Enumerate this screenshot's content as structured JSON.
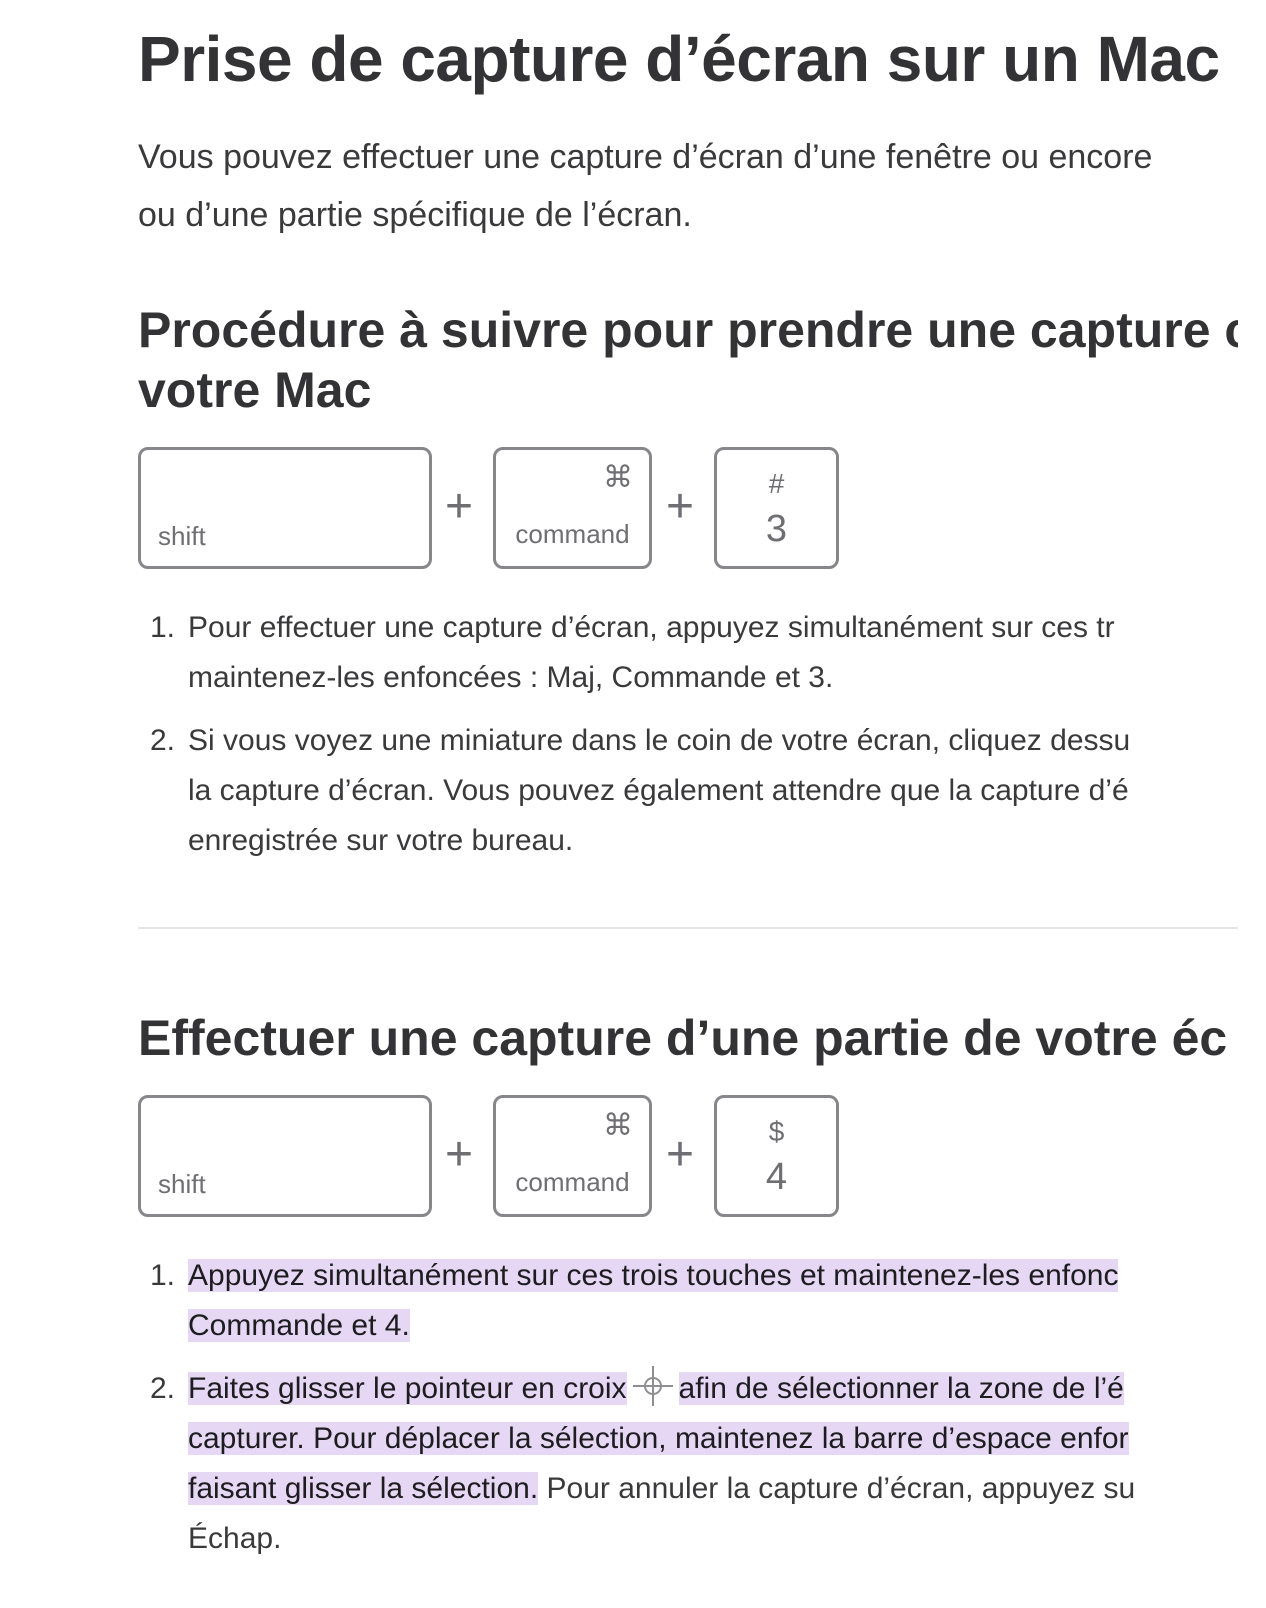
{
  "page": {
    "title": "Prise de capture d’écran sur un Mac",
    "intro_lines": [
      "Vous pouvez effectuer une capture d’écran d’une fenêtre ou encore",
      "ou d’une partie spécifique de l’écran."
    ]
  },
  "section1": {
    "heading_lines": [
      "Procédure à suivre pour prendre une capture c",
      "votre Mac"
    ],
    "keys": {
      "shift": "shift",
      "command_symbol": "⌘",
      "command": "command",
      "number_symbol": "#",
      "number": "3",
      "plus": "+"
    },
    "steps": [
      {
        "num": "1.",
        "lines": [
          "Pour effectuer une capture d’écran, appuyez simultanément sur ces tr",
          "maintenez-les enfoncées : Maj, Commande et 3."
        ]
      },
      {
        "num": "2.",
        "lines": [
          "Si vous voyez une miniature dans le coin de votre écran, cliquez dessu",
          "la capture d’écran. Vous pouvez également attendre que la capture d’é",
          "enregistrée sur votre bureau."
        ]
      }
    ]
  },
  "section2": {
    "heading_lines": [
      "Effectuer une capture d’une partie de votre éc"
    ],
    "keys": {
      "shift": "shift",
      "command_symbol": "⌘",
      "command": "command",
      "number_symbol": "$",
      "number": "4",
      "plus": "+"
    },
    "steps": [
      {
        "num": "1.",
        "line1": "Appuyez simultanément sur ces trois touches et maintenez-les enfonc",
        "line2": "Commande et 4."
      },
      {
        "num": "2.",
        "line1_a": "Faites glisser le pointeur en croix",
        "line1_icon": "crosshair-cursor-icon",
        "line1_b": "afin de sélectionner la zone de l’é",
        "line2": "capturer. Pour déplacer la sélection, maintenez la barre d’espace enfor",
        "line3_hl": "faisant glisser la sélection.",
        "line3_rest": " Pour annuler la capture d’écran, appuyez su",
        "line4": "Échap."
      }
    ]
  },
  "colors": {
    "highlight": "#e6d7f5",
    "key_border": "#86868b",
    "text": "#3a3a3c",
    "heading": "#333336"
  }
}
